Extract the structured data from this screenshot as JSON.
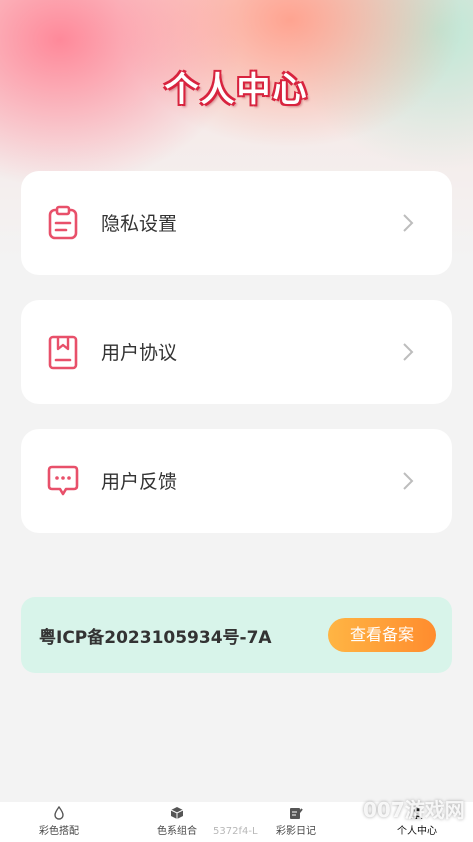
{
  "page": {
    "title": "个人中心"
  },
  "menu": [
    {
      "label": "隐私设置",
      "icon": "clipboard-icon"
    },
    {
      "label": "用户协议",
      "icon": "bookmark-document-icon"
    },
    {
      "label": "用户反馈",
      "icon": "chat-bubble-icon"
    }
  ],
  "icp": {
    "text": "粤ICP备2023105934号-7A",
    "button_label": "查看备案"
  },
  "bottom_nav": [
    {
      "label": "彩色搭配",
      "icon": "paint-drop-icon"
    },
    {
      "label": "色系组合",
      "icon": "cube-icon"
    },
    {
      "label": "彩影日记",
      "icon": "note-pen-icon"
    },
    {
      "label": "个人中心",
      "icon": "person-icon"
    }
  ],
  "version_text": "5372f4-L",
  "watermark_text": "007游戏网",
  "colors": {
    "accent": "#e8506a",
    "icp_bg": "#d8f4ea",
    "button_orange": "#ff9a35"
  }
}
